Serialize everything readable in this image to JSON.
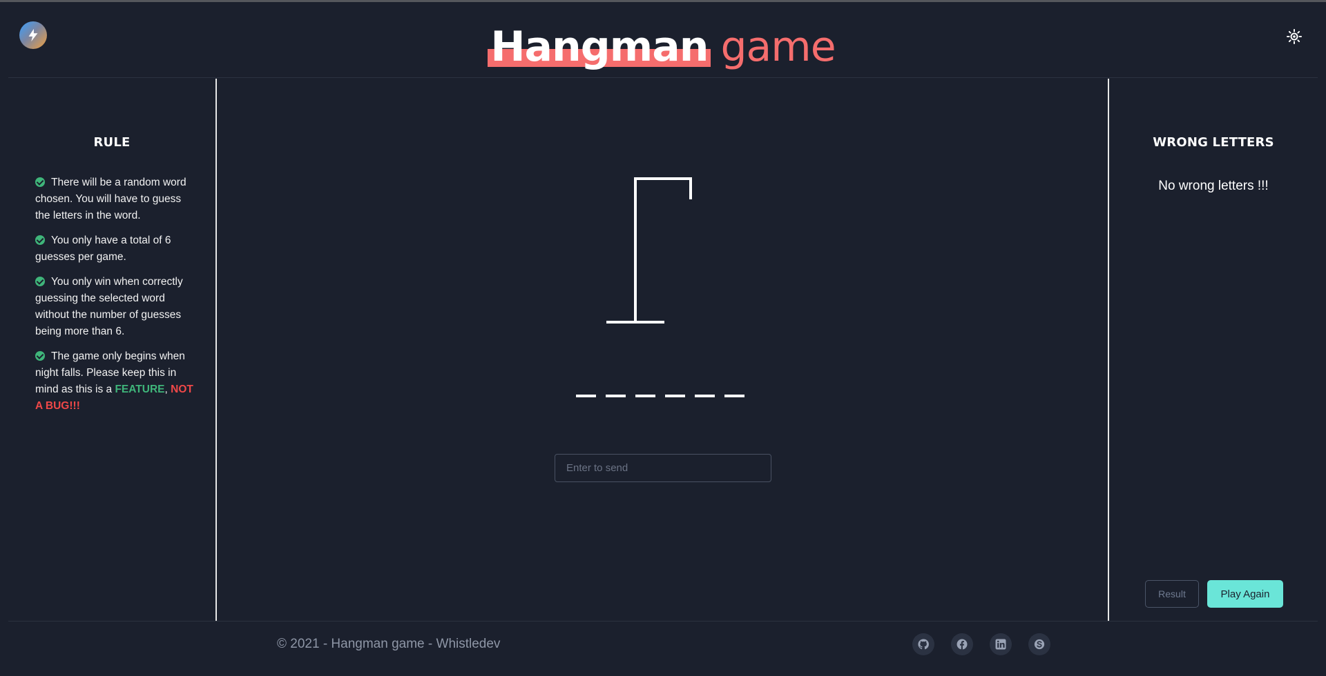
{
  "header": {
    "title_main": "Hangman",
    "title_accent": "game",
    "theme_toggle_icon": "sun-icon"
  },
  "left_panel": {
    "title": "RULE",
    "rules": [
      "There will be a random word chosen. You will have to guess the letters in the word.",
      "You only have a total of 6 guesses per game.",
      "You only win when correctly guessing the selected word without the number of guesses being more than 6.",
      "The game only begins when night falls. Please keep this in mind as this is a"
    ],
    "feature_text": "FEATURE",
    "separator": ",",
    "not_bug_text": "NOT A BUG!!!"
  },
  "game": {
    "word_length": 6,
    "input_placeholder": "Enter to send"
  },
  "right_panel": {
    "title": "WRONG LETTERS",
    "status": "No wrong letters !!!",
    "result_label": "Result",
    "play_again_label": "Play Again"
  },
  "footer": {
    "copyright": "© 2021 - Hangman game - Whistledev",
    "socials": [
      "github-icon",
      "facebook-icon",
      "linkedin-icon",
      "skype-icon"
    ]
  },
  "colors": {
    "background": "#1b202d",
    "accent_red": "#f56d6d",
    "feature_green": "#3fb57a",
    "bug_red": "#f04848",
    "play_button": "#6ae5d8"
  }
}
